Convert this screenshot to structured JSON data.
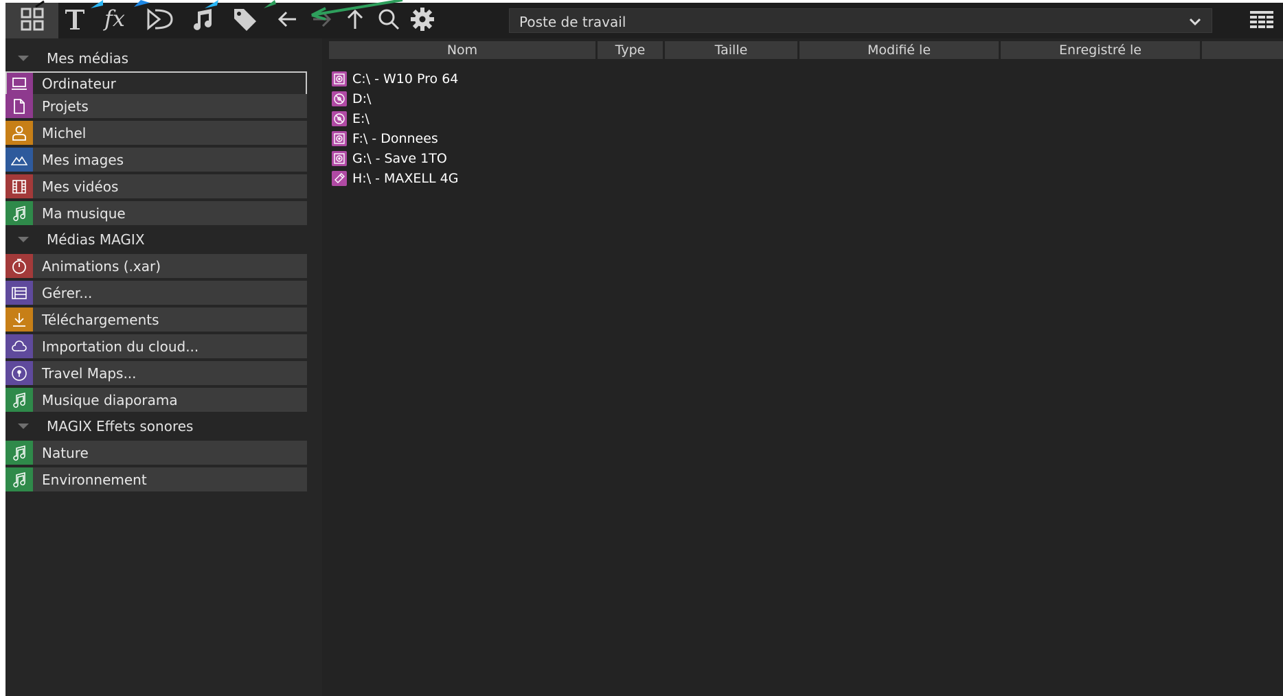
{
  "toolbar": {
    "tabs": [
      {
        "icon": "grid-icon",
        "active": true
      },
      {
        "icon": "text-icon",
        "active": false
      },
      {
        "icon": "fx-icon",
        "active": false
      },
      {
        "icon": "transition-icon",
        "active": false
      },
      {
        "icon": "music-note-icon",
        "active": false
      },
      {
        "icon": "tag-icon",
        "active": false
      }
    ],
    "nav": [
      "back-arrow-icon",
      "forward-arrow-icon",
      "up-arrow-icon",
      "search-icon",
      "gear-icon"
    ],
    "path": "Poste de travail",
    "view_toggle_icon": "list-view-icon"
  },
  "sidebar": {
    "sections": [
      {
        "title": "Mes médias",
        "items": [
          {
            "label": "Ordinateur",
            "icon": "computer-icon",
            "color": "#8e3a8e",
            "selected": true
          },
          {
            "label": "Projets",
            "icon": "document-icon",
            "color": "#8e3a8e"
          },
          {
            "label": "Michel",
            "icon": "user-icon",
            "color": "#c77f17"
          },
          {
            "label": "Mes images",
            "icon": "mountain-icon",
            "color": "#2e5a9c"
          },
          {
            "label": "Mes vidéos",
            "icon": "film-icon",
            "color": "#a33a3a"
          },
          {
            "label": "Ma musique",
            "icon": "music-note-icon",
            "color": "#2f8a4a"
          }
        ]
      },
      {
        "title": "Médias MAGIX",
        "items": [
          {
            "label": "Animations (.xar)",
            "icon": "timer-icon",
            "color": "#a33a3a"
          },
          {
            "label": "Gérer...",
            "icon": "manage-icon",
            "color": "#5f4a9c"
          },
          {
            "label": "Téléchargements",
            "icon": "download-icon",
            "color": "#c77f17"
          },
          {
            "label": "Importation du cloud...",
            "icon": "cloud-icon",
            "color": "#5f4a9c"
          },
          {
            "label": "Travel Maps...",
            "icon": "map-pin-icon",
            "color": "#5f4a9c"
          },
          {
            "label": "Musique diaporama",
            "icon": "music-note-icon",
            "color": "#2f8a4a"
          }
        ]
      },
      {
        "title": "MAGIX Effets sonores",
        "items": [
          {
            "label": "Nature",
            "icon": "music-note-icon",
            "color": "#2f8a4a"
          },
          {
            "label": "Environnement",
            "icon": "music-note-icon",
            "color": "#2f8a4a"
          }
        ]
      }
    ]
  },
  "filelist": {
    "columns": [
      "Nom",
      "Type",
      "Taille",
      "Modifié le",
      "Enregistré le"
    ],
    "rows": [
      {
        "name": "C:\\ - W10 Pro 64",
        "icon": "hard-drive-icon"
      },
      {
        "name": "D:\\",
        "icon": "optical-drive-icon"
      },
      {
        "name": "E:\\",
        "icon": "optical-drive-icon"
      },
      {
        "name": "F:\\ - Donnees",
        "icon": "hard-drive-icon"
      },
      {
        "name": "G:\\ - Save 1TO",
        "icon": "hard-drive-icon"
      },
      {
        "name": "H:\\ - MAXELL 4G",
        "icon": "usb-drive-icon"
      }
    ]
  },
  "annotation_colors": {
    "blue": "#1e88e5",
    "cyan": "#29b6f6",
    "green": "#2e9f5c"
  }
}
